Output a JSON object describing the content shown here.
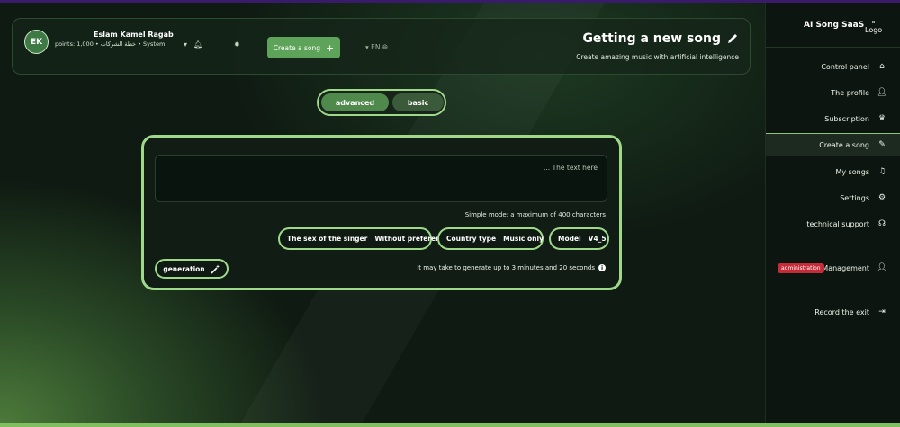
{
  "header": {
    "avatar_initials": "EK",
    "user_name": "Eslam Kamel Ragab",
    "user_meta": "points: 1,000 • خطة الشركات • System",
    "create_song_label": "Create a song",
    "language": "EN",
    "page_title": "Getting a new song",
    "page_subtitle": "Create amazing music with artificial intelligence"
  },
  "mode_toggle": {
    "advanced_label": "advanced",
    "basic_label": "basic"
  },
  "form": {
    "text_placeholder": "... The text here",
    "char_hint": "Simple mode: a maximum of 400 characters",
    "singer_label": "The sex of the singer",
    "singer_value": "Without preference",
    "country_label": "Country type",
    "country_value": "Music only",
    "model_label": "Model",
    "model_value": "V4_5",
    "generate_label": "generation",
    "time_note": "It may take to generate up to 3 minutes and 20 seconds"
  },
  "sidebar": {
    "app_name": "AI Song SaaS",
    "logo_alt": "Logo",
    "items": [
      {
        "label": "Control panel",
        "icon": "home-icon"
      },
      {
        "label": "The profile",
        "icon": "user-icon"
      },
      {
        "label": "Subscription",
        "icon": "crown-icon"
      },
      {
        "label": "Create a song",
        "icon": "pencil-icon"
      },
      {
        "label": "My songs",
        "icon": "music-icon"
      },
      {
        "label": "Settings",
        "icon": "gear-icon"
      },
      {
        "label": "technical support",
        "icon": "headset-icon"
      },
      {
        "label": "Management",
        "icon": "user-gear-icon"
      },
      {
        "label": "Record the exit",
        "icon": "logout-icon"
      }
    ],
    "admin_badge": "administration"
  },
  "colors": {
    "accent": "#9fd88a",
    "button": "#5ea35a",
    "badge": "#c82b38"
  }
}
